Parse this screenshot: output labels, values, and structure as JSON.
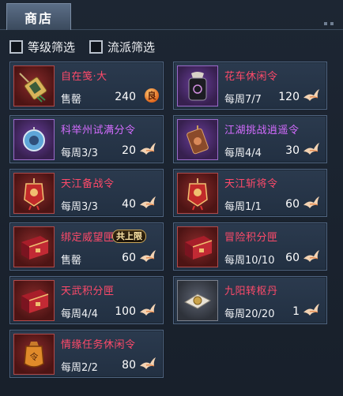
{
  "header": {
    "tab_label": "商店"
  },
  "filters": [
    {
      "label": "等级筛选",
      "checked": false
    },
    {
      "label": "流派筛选",
      "checked": false
    }
  ],
  "colors": {
    "name_red": "#ff4a6a",
    "name_purple": "#d46cff",
    "card_bg": "#2b3a4e",
    "card_border": "#4f6480"
  },
  "items": [
    {
      "name": "自在笺·大",
      "name_color": "red",
      "limit": "售罄",
      "price": "240",
      "currency_icon": "liang-currency-icon",
      "currency_glyph": "良",
      "icon": "tassel-token-icon",
      "quality": "red"
    },
    {
      "name": "花车休闲令",
      "name_color": "red",
      "limit": "每周7/7",
      "price": "120",
      "currency_icon": "swallow-currency-icon",
      "icon": "black-seal-token-icon",
      "quality": "purple"
    },
    {
      "name": "科举州试满分令",
      "name_color": "purple",
      "limit": "每周3/3",
      "price": "20",
      "currency_icon": "swallow-currency-icon",
      "icon": "jade-pendant-icon",
      "quality": "purple"
    },
    {
      "name": "江湖挑战逍遥令",
      "name_color": "purple",
      "limit": "每周4/4",
      "price": "30",
      "currency_icon": "swallow-currency-icon",
      "icon": "bronze-token-icon",
      "quality": "purple"
    },
    {
      "name": "天江备战令",
      "name_color": "red",
      "limit": "每周3/3",
      "price": "40",
      "currency_icon": "swallow-currency-icon",
      "icon": "red-tassel-token-icon",
      "quality": "red"
    },
    {
      "name": "天江斩将令",
      "name_color": "red",
      "limit": "每周1/1",
      "price": "60",
      "currency_icon": "swallow-currency-icon",
      "icon": "red-tassel-token-icon",
      "quality": "red"
    },
    {
      "name": "绑定威望匣",
      "name_color": "red",
      "limit": "售罄",
      "price": "60",
      "currency_icon": "swallow-currency-icon",
      "badge": "共上限",
      "icon": "red-chest-icon",
      "quality": "red"
    },
    {
      "name": "冒险积分匣",
      "name_color": "red",
      "limit": "每周10/10",
      "price": "60",
      "currency_icon": "swallow-currency-icon",
      "icon": "red-chest-icon",
      "quality": "red"
    },
    {
      "name": "天武积分匣",
      "name_color": "red",
      "limit": "每周4/4",
      "price": "100",
      "currency_icon": "swallow-currency-icon",
      "icon": "red-chest-icon",
      "quality": "red"
    },
    {
      "name": "九阳转枢丹",
      "name_color": "red",
      "limit": "每周20/20",
      "price": "1",
      "currency_icon": "swallow-currency-icon",
      "icon": "pill-packet-icon",
      "quality": "gray"
    },
    {
      "name": "情缘任务休闲令",
      "name_color": "red",
      "limit": "每周2/2",
      "price": "80",
      "currency_icon": "swallow-currency-icon",
      "icon": "orange-pouch-token-icon",
      "quality": "red"
    }
  ]
}
